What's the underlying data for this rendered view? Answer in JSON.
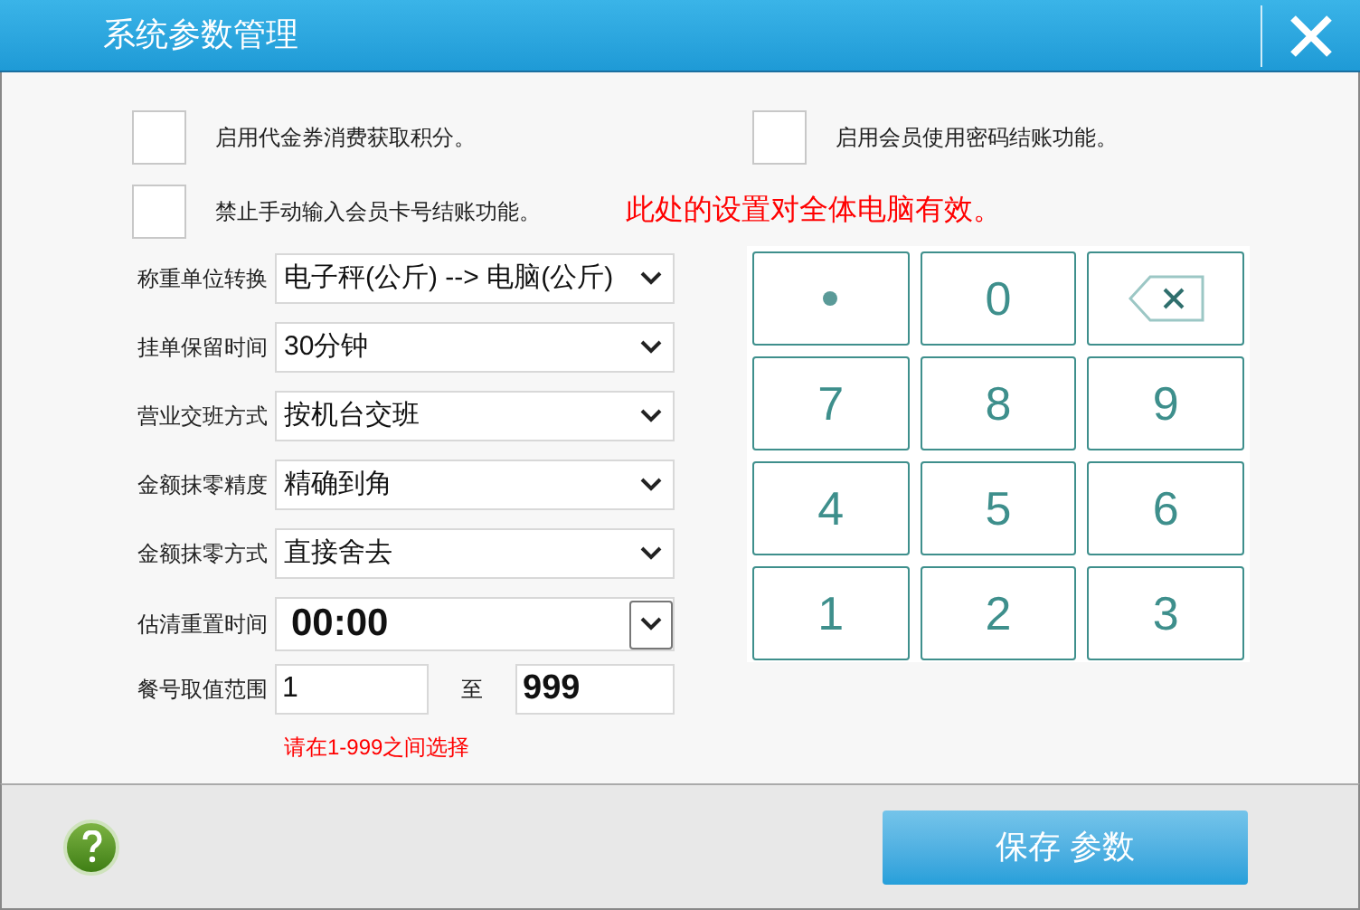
{
  "window": {
    "title": "系统参数管理"
  },
  "options": [
    {
      "label": "启用代金券消费获取积分。",
      "checked": false
    },
    {
      "label": "启用会员使用密码结账功能。",
      "checked": false
    },
    {
      "label": "禁止手动输入会员卡号结账功能。",
      "checked": false
    }
  ],
  "notice": "此处的设置对全体电脑有效。",
  "settings": [
    {
      "kind": "select",
      "label": "称重单位转换",
      "value": "电子秤(公斤) --> 电脑(公斤)"
    },
    {
      "kind": "select",
      "label": "挂单保留时间",
      "value": "30分钟"
    },
    {
      "kind": "select",
      "label": "营业交班方式",
      "value": "按机台交班"
    },
    {
      "kind": "select",
      "label": "金额抹零精度",
      "value": "精确到角"
    },
    {
      "kind": "select",
      "label": "金额抹零方式",
      "value": "直接舍去"
    },
    {
      "kind": "time",
      "label": "估清重置时间",
      "value": "00:00"
    },
    {
      "kind": "range",
      "label": "餐号取值范围",
      "from": "1",
      "separator": "至",
      "to": "999"
    }
  ],
  "hint": "请在1-999之间选择",
  "keypad": [
    {
      "kind": "dot"
    },
    {
      "kind": "digit",
      "label": "0"
    },
    {
      "kind": "backspace"
    },
    {
      "kind": "digit",
      "label": "7"
    },
    {
      "kind": "digit",
      "label": "8"
    },
    {
      "kind": "digit",
      "label": "9"
    },
    {
      "kind": "digit",
      "label": "4"
    },
    {
      "kind": "digit",
      "label": "5"
    },
    {
      "kind": "digit",
      "label": "6"
    },
    {
      "kind": "digit",
      "label": "1"
    },
    {
      "kind": "digit",
      "label": "2"
    },
    {
      "kind": "digit",
      "label": "3"
    }
  ],
  "footer": {
    "save_button": "保存 参数"
  }
}
